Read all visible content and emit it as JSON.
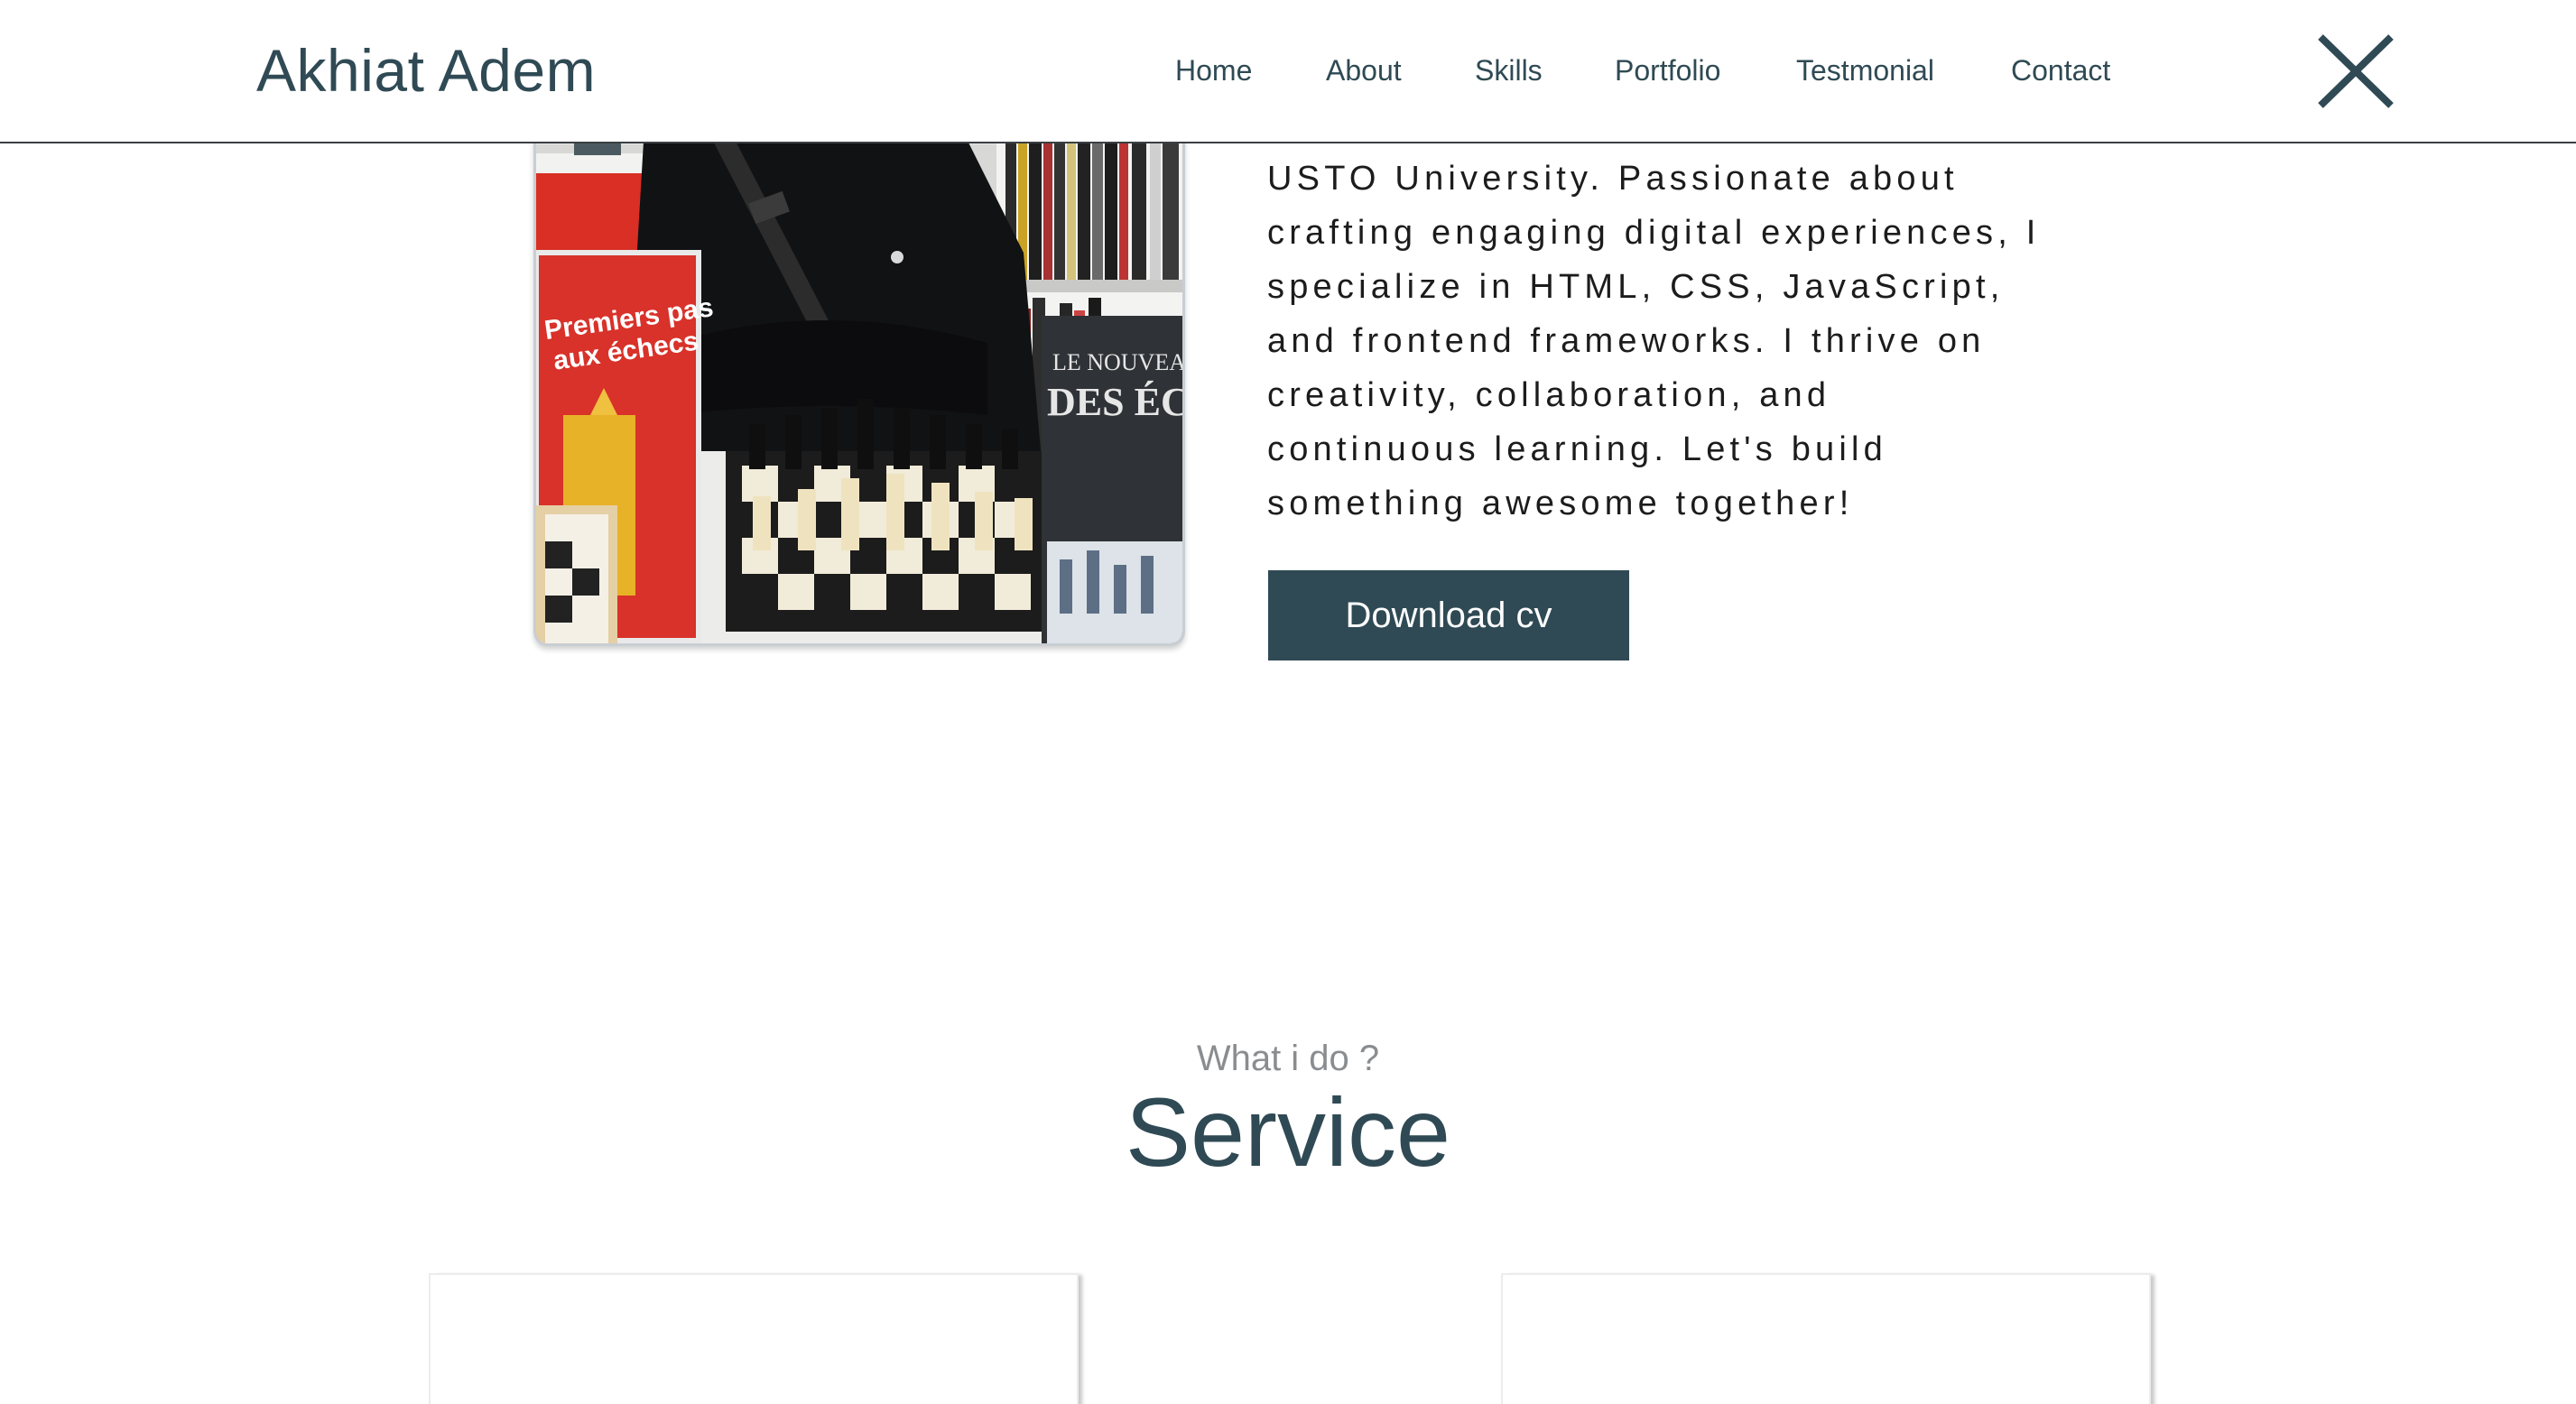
{
  "header": {
    "logo": "Akhiat Adem",
    "nav": [
      {
        "label": "Home"
      },
      {
        "label": "About"
      },
      {
        "label": "Skills"
      },
      {
        "label": "Portfolio"
      },
      {
        "label": "Testmonial"
      },
      {
        "label": "Contact"
      }
    ],
    "close_icon": "close-icon"
  },
  "about": {
    "lines": [
      "USTO University. Passionate about",
      "crafting engaging digital experiences, I",
      "specialize in HTML, CSS, JavaScript,",
      "and frontend frameworks. I thrive on",
      "creativity, collaboration, and",
      "continuous learning. Let's build",
      "something awesome together!"
    ],
    "download_label": "Download cv",
    "photo_book_left": "Premiers pas aux échecs",
    "photo_book_right": "LE NOUVEAU G DES ÉCHE"
  },
  "services": {
    "subtitle": "What i do ?",
    "title": "Service"
  },
  "colors": {
    "primary": "#2f4a54",
    "text": "#1c1c1c",
    "muted": "#8a8d90"
  }
}
